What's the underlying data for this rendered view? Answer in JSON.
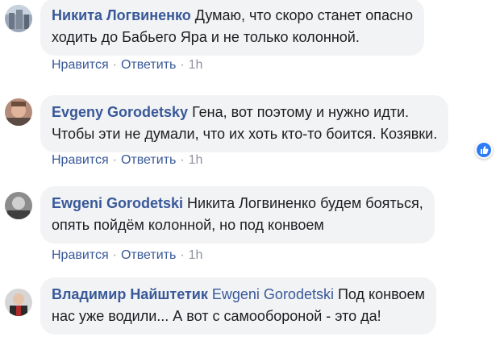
{
  "comments": [
    {
      "author": "Никита Логвиненко",
      "text_line1": "Думаю, что скоро станет опасно",
      "text_line2": "ходить до Бабьего Яра и не только колонной.",
      "like_label": "Нравится",
      "reply_label": "Ответить",
      "separator": "·",
      "time": "1h"
    },
    {
      "author": "Evgeny Gorodetsky",
      "text_line1": "Гена, вот поэтому и нужно идти.",
      "text_line2": "Чтобы эти не думали, что их хоть кто-то боится. Козявки.",
      "like_label": "Нравится",
      "reply_label": "Ответить",
      "separator": "·",
      "time": "1h",
      "reaction_icon": "thumbs-up-icon",
      "reaction_color": "#2d7cf6"
    },
    {
      "author": "Ewgeni Gorodetski",
      "text_line1": "Никита Логвиненко будем бояться,",
      "text_line2": "опять пойдём колонной, но под конвоем",
      "like_label": "Нравится",
      "reply_label": "Ответить",
      "separator": "·",
      "time": "1h"
    },
    {
      "author": "Владимир Найштетик",
      "mention": "Ewgeni Gorodetski",
      "text_line1": "Под конвоем",
      "text_line2": "нас уже водили... А вот с самообороной - это да!"
    }
  ],
  "colors": {
    "author": "#385898",
    "text": "#1c1e21",
    "bubble": "#f2f3f5",
    "meta": "#90949c"
  }
}
